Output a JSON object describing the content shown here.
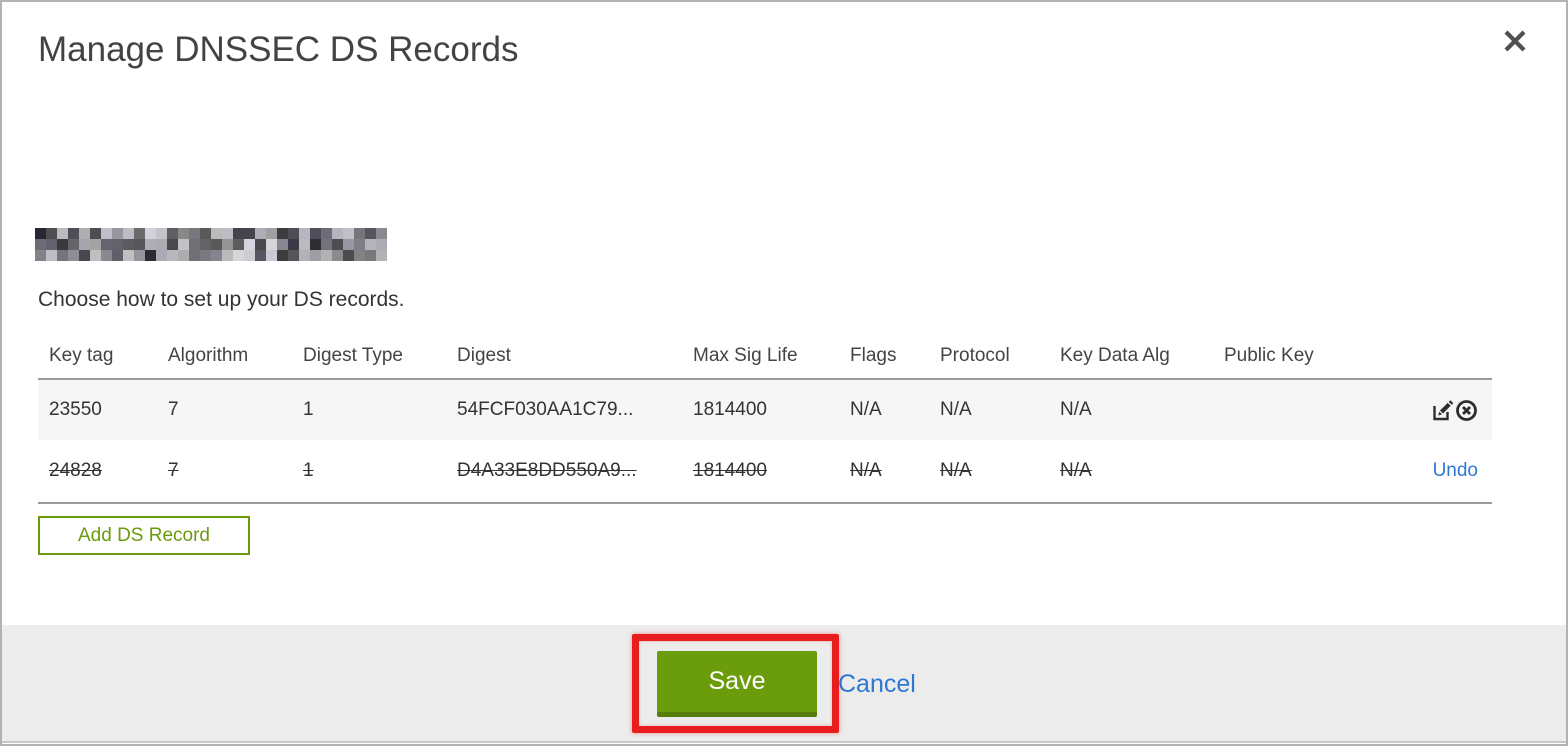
{
  "modal": {
    "title": "Manage DNSSEC DS Records",
    "intro": "Choose how to set up your DS records."
  },
  "table": {
    "columns": [
      "Key tag",
      "Algorithm",
      "Digest Type",
      "Digest",
      "Max Sig Life",
      "Flags",
      "Protocol",
      "Key Data Alg",
      "Public Key"
    ],
    "rows": [
      {
        "key_tag": "23550",
        "algorithm": "7",
        "digest_type": "1",
        "digest": "54FCF030AA1C79...",
        "max_sig_life": "1814400",
        "flags": "N/A",
        "protocol": "N/A",
        "key_data_alg": "N/A",
        "public_key": "",
        "status": "active"
      },
      {
        "key_tag": "24828",
        "algorithm": "7",
        "digest_type": "1",
        "digest": "D4A33E8DD550A9...",
        "max_sig_life": "1814400",
        "flags": "N/A",
        "protocol": "N/A",
        "key_data_alg": "N/A",
        "public_key": "",
        "status": "marked-for-deletion"
      }
    ]
  },
  "actions": {
    "add_ds_record": "Add DS Record",
    "undo": "Undo",
    "save": "Save",
    "cancel": "Cancel"
  },
  "icons": {
    "close": "close-icon",
    "edit": "edit-pencil-icon",
    "delete": "delete-circle-x-icon"
  },
  "colors": {
    "accent_green": "#6b9c0b",
    "accent_green_dark": "#567d08",
    "link_blue": "#2e77d4",
    "annotation_red": "#e81e1e",
    "footer_gray": "#ececec",
    "row_gray": "#f6f6f6",
    "border_gray": "#9b9b9b"
  }
}
